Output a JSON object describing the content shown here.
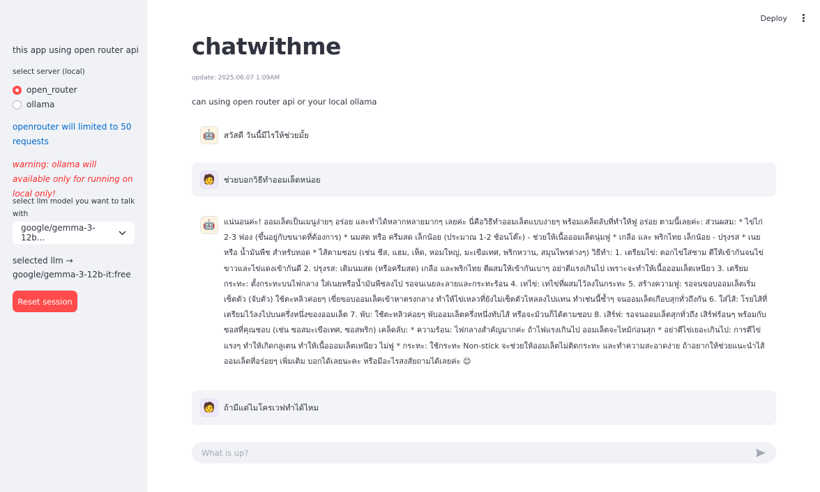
{
  "sidebar": {
    "intro": "this app using open router api",
    "server_label": "select server (local)",
    "server_options": [
      "open_router",
      "ollama"
    ],
    "info": "openrouter will limited to 50 requests",
    "warning": "warning: ollama will available only for running on local only!",
    "model_label": "select llm model you want to talk with",
    "model_value": "google/gemma-3-12b...",
    "selected_llm": "selected llm → google/gemma-3-12b-it:free",
    "reset_label": "Reset session"
  },
  "header": {
    "deploy": "Deploy",
    "menu_icon": "⋮"
  },
  "main": {
    "title": "chatwithme",
    "update": "update: 2025.06.07 1:09AM",
    "subtitle": "can using open router api or your local ollama"
  },
  "messages": [
    {
      "role": "assistant",
      "text": "สวัสดี วันนี้มีไรให้ช่วยมั้ย"
    },
    {
      "role": "user",
      "text": "ช่วยบอกวิธีทำออมเล็ตหน่อย"
    },
    {
      "role": "assistant",
      "text": "แน่นอนค่ะ! ออมเล็ตเป็นเมนูง่ายๆ อร่อย และทำได้หลากหลายมากๆ เลยค่ะ นี่คือวิธีทำออมเล็ตแบบง่ายๆ พร้อมเคล็ดลับที่ทำให้ฟู อร่อย ตามนี้เลยค่ะ: ส่วนผสม: * ไข่ไก่ 2-3 ฟอง (ขึ้นอยู่กับขนาดที่ต้องการ) * นมสด หรือ ครีมสด เล็กน้อย (ประมาณ 1-2 ช้อนโต๊ะ) - ช่วยให้เนื้อออมเล็ตนุ่มฟู * เกลือ และ พริกไทย เล็กน้อย - ปรุงรส * เนย หรือ น้ำมันพืช สำหรับทอด * ไส้ตามชอบ (เช่น ชีส, แฮม, เห็ด, หอมใหญ่, มะเขือเทศ, พริกหวาน, สมุนไพรต่างๆ) วิธีทำ: 1. เตรียมไข่: ตอกไข่ใส่ชาม ตีให้เข้ากันจนไข่ขาวและไข่แดงเข้ากันดี 2. ปรุงรส: เติมนมสด (หรือครีมสด) เกลือ และพริกไทย ตีผสมให้เข้ากันเบาๆ อย่าตีแรงเกินไป เพราะจะทำให้เนื้อออมเล็ตเหนียว 3. เตรียมกระทะ: ตั้งกระทะบนไฟกลาง ใส่เนยหรือน้ำมันพืชลงไป รอจนเนยละลายและกระทะร้อน 4. เทไข่: เทไข่ที่ผสมไว้ลงในกระทะ 5. สร้างความฟู: รอจนขอบออมเล็ตเริ่มเซ็ตตัว (จับตัว) ใช้ตะหลิวค่อยๆ เขี่ยขอบออมเล็ตเข้าหาตรงกลาง ทำให้ไข่เหลวที่ยังไม่เซ็ตตัวไหลลงไปแทน ทำเช่นนี้ซ้ำๆ จนออมเล็ตเกือบสุกทั่วถึงกัน 6. ใส่ไส้: โรยไส้ที่เตรียมไว้ลงไปบนครึ่งหนึ่งของออมเล็ต 7. พับ: ใช้ตะหลิวค่อยๆ พับออมเล็ตครึ่งหนึ่งทับไส้ หรือจะม้วนก็ได้ตามชอบ 8. เสิร์ฟ: รอจนออมเล็ตสุกทั่วถึง เสิร์ฟร้อนๆ พร้อมกับซอสที่คุณชอบ (เช่น ซอสมะเขือเทศ, ซอสพริก) เคล็ดลับ: * ความร้อน: ไฟกลางสำคัญมากค่ะ ถ้าไฟแรงเกินไป ออมเล็ตจะไหม้ก่อนสุก * อย่าตีไข่เยอะเกินไป: การตีไข่แรงๆ ทำให้เกิดกลูเตน ทำให้เนื้อออมเล็ตเหนียว ไม่ฟู * กระทะ: ใช้กระทะ Non-stick จะช่วยให้ออมเล็ตไม่ติดกระทะ และทำความสะอาดง่าย ถ้าอยากให้ช่วยแนะนำไส้ออมเล็ตที่อร่อยๆ เพิ่มเติม บอกได้เลยนะคะ หรือมีอะไรสงสัยถามได้เลยค่ะ 😊"
    },
    {
      "role": "user",
      "text": "ถ้ามีแต่ไมโครเวฟทำได้ไหม"
    }
  ],
  "chat_input": {
    "placeholder": "What is up?"
  }
}
